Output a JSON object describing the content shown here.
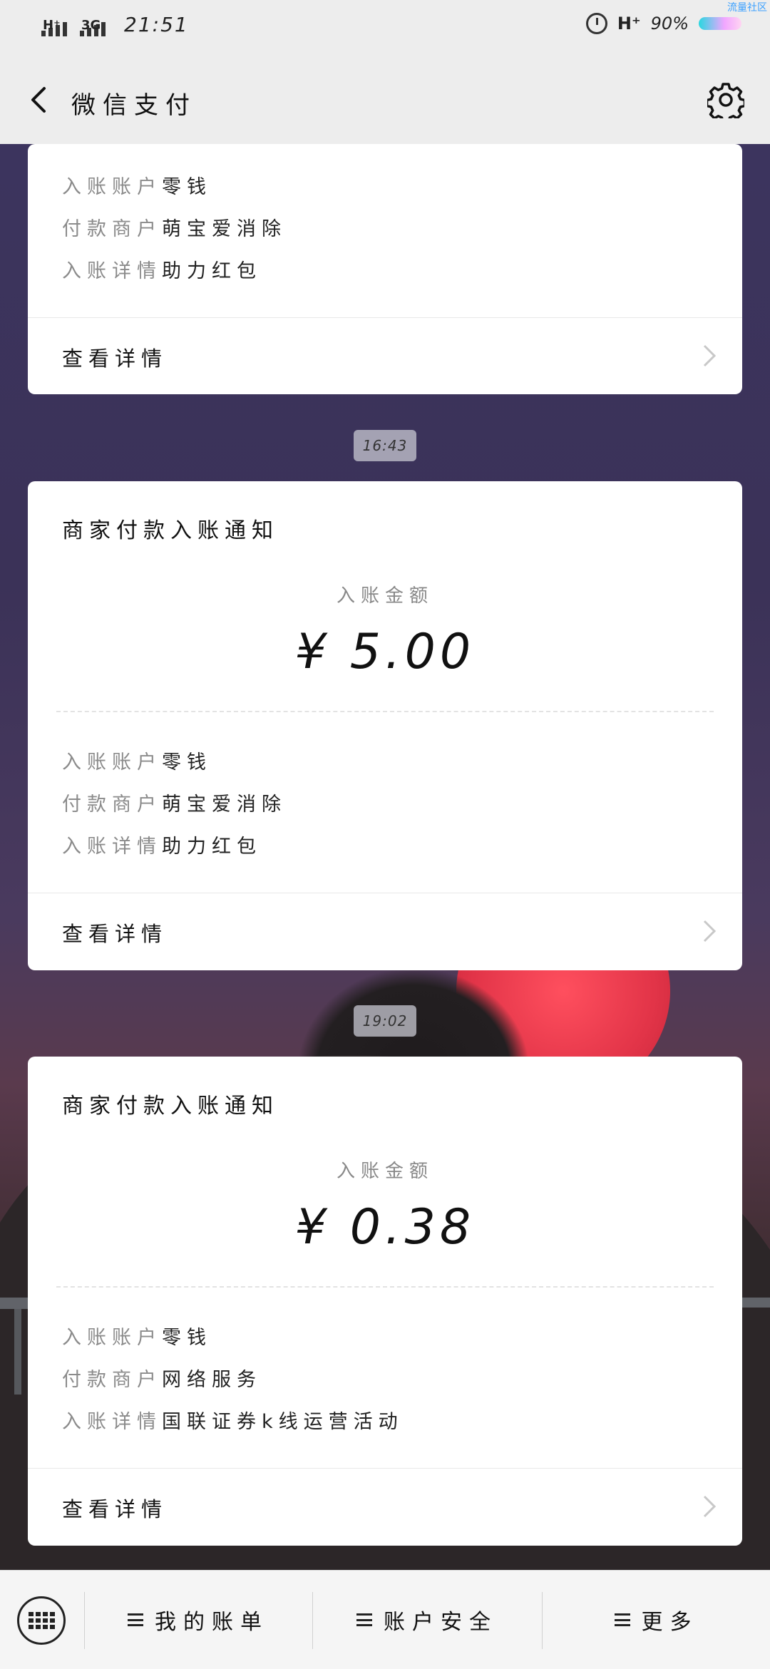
{
  "status_bar": {
    "signal1_label": "H⁺",
    "signal2_label": "3G",
    "time": "21:51",
    "network_right": "H⁺",
    "battery": "90%",
    "corner_text": "流量社区"
  },
  "header": {
    "title": "微信支付"
  },
  "top_card": {
    "rows": [
      {
        "key": "入账账户",
        "value": "零钱"
      },
      {
        "key": "付款商户",
        "value": "萌宝爱消除"
      },
      {
        "key": "入账详情",
        "value": "助力红包"
      }
    ],
    "view_label": "查看详情"
  },
  "messages": [
    {
      "time": "16:43",
      "title": "商家付款入账通知",
      "amount_label": "入账金额",
      "amount": "¥ 5.00",
      "rows": [
        {
          "key": "入账账户",
          "value": "零钱"
        },
        {
          "key": "付款商户",
          "value": "萌宝爱消除"
        },
        {
          "key": "入账详情",
          "value": "助力红包"
        }
      ],
      "view_label": "查看详情"
    },
    {
      "time": "19:02",
      "title": "商家付款入账通知",
      "amount_label": "入账金额",
      "amount": "¥ 0.38",
      "rows": [
        {
          "key": "入账账户",
          "value": "零钱"
        },
        {
          "key": "付款商户",
          "value": "网络服务"
        },
        {
          "key": "入账详情",
          "value": "国联证券k线运营活动"
        }
      ],
      "view_label": "查看详情"
    }
  ],
  "bottom_menu": {
    "items": [
      "我的账单",
      "账户安全",
      "更多"
    ]
  },
  "colors": {
    "bar_bg": "#ededed",
    "card_bg": "#ffffff",
    "muted_text": "#8b8b8b"
  }
}
